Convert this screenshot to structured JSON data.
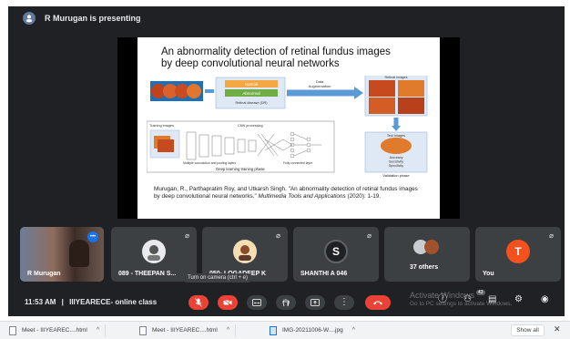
{
  "presenter": {
    "text": "R Murugan is presenting"
  },
  "slide": {
    "title_line1": "An abnormality detection of retinal fundus images",
    "title_line2": "by deep convolutional neural networks",
    "diagram": {
      "normal": "Normal",
      "abnormal": "Abnormal",
      "retinal_disease": "Retinal disease (DR)",
      "data_augmentation_1": "Data",
      "data_augmentation_2": "Augmentation",
      "retinal_images": "Retinal images",
      "training_images": "Training images",
      "cnn_processing": "CNN processing",
      "multiple_conv": "Multiple convolution and pooling layers",
      "fully_connected": "Fully connected layer",
      "deep_learning_phase": "Deep learning training phase",
      "test_images": "Test images",
      "metrics_1": "Accuracy",
      "metrics_2": "Sensitivity",
      "metrics_3": "Specificity",
      "validation_phase": "Validation phase"
    },
    "citation_main": "Murugan, R., Parthapratim Roy, and Utkarsh Singh. \"An abnormality detection of retinal fundus images by deep convolutional neural networks.\"",
    "citation_journal": "Multimedia Tools and Applications",
    "citation_tail": "(2020): 1-19."
  },
  "participants": [
    {
      "name": "R Murugan"
    },
    {
      "name": "089 - THEEPAN S..."
    },
    {
      "name": "050- LOGADEEP K"
    },
    {
      "name": "SHANTHI A 046",
      "initial": "S"
    },
    {
      "name": "37 others"
    },
    {
      "name": "You",
      "initial": "T"
    }
  ],
  "meeting": {
    "time": "11:53 AM",
    "separator": "|",
    "title": "IIIYEARECE- online class"
  },
  "tooltip": "Turn on camera (ctrl + e)",
  "people_badge": "43",
  "watermark": {
    "line1": "Activate Windows",
    "line2": "Go to PC settings to activate Windows."
  },
  "downloads": [
    {
      "name": "Meet - IIIYEAREC....html"
    },
    {
      "name": "Meet - IIIYEAREC....html"
    },
    {
      "name": "IMG-20211006-W....jpg"
    }
  ],
  "show_all": "Show all",
  "colors": {
    "background": "#202124",
    "tile": "#3c4043",
    "end_call": "#ea4335",
    "accent_blue": "#1a73e8"
  }
}
